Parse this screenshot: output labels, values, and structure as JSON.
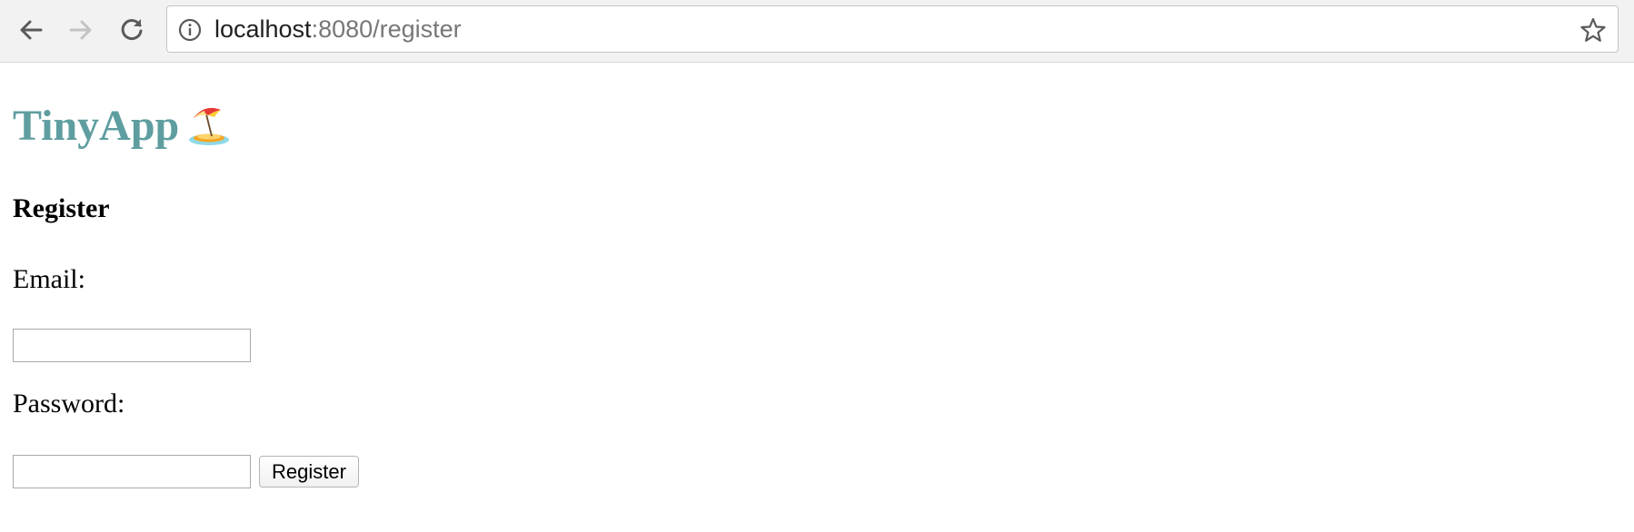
{
  "browser": {
    "url_host": "localhost",
    "url_rest": ":8080/register",
    "icons": {
      "back": "back-arrow-icon",
      "forward": "forward-arrow-icon",
      "reload": "reload-icon",
      "info": "info-icon",
      "bookmark": "star-icon"
    }
  },
  "page": {
    "app_title": "TinyApp",
    "app_emoji": "beach-umbrella-island",
    "heading": "Register",
    "email_label": "Email:",
    "email_value": "",
    "password_label": "Password:",
    "password_value": "",
    "submit_label": "Register"
  },
  "colors": {
    "title": "#5f9ea0",
    "toolbar_bg": "#f2f2f2"
  }
}
